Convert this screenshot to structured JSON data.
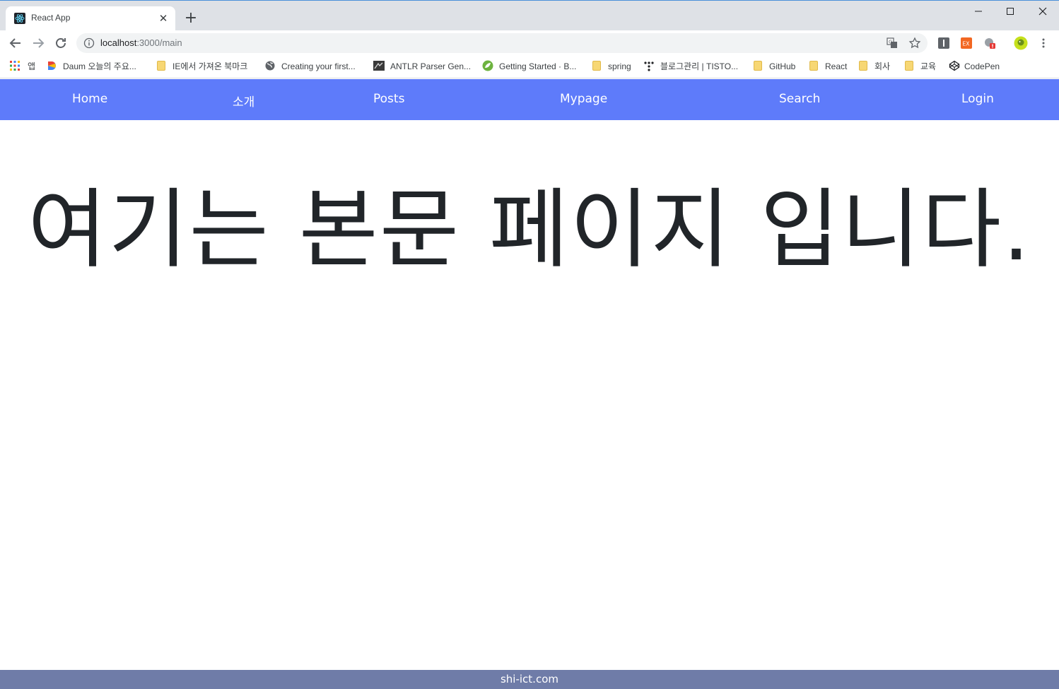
{
  "browser": {
    "tab_title": "React App",
    "url_host": "localhost",
    "url_path": ":3000/main",
    "bookmarks": [
      {
        "label": "앱",
        "icon": "apps-grid-icon"
      },
      {
        "label": "Daum 오늘의 주요...",
        "icon": "daum-icon"
      },
      {
        "label": "IE에서 가져온 북마크",
        "icon": "folder-icon"
      },
      {
        "label": "Creating your first...",
        "icon": "globe-icon"
      },
      {
        "label": "ANTLR Parser Gen...",
        "icon": "antlr-icon"
      },
      {
        "label": "Getting Started · B...",
        "icon": "spring-icon"
      },
      {
        "label": "spring",
        "icon": "folder-icon"
      },
      {
        "label": "블로그관리 | TISTO...",
        "icon": "tistory-icon"
      },
      {
        "label": "GitHub",
        "icon": "folder-icon"
      },
      {
        "label": "React",
        "icon": "folder-icon"
      },
      {
        "label": "회사",
        "icon": "folder-icon"
      },
      {
        "label": "교육",
        "icon": "folder-icon"
      },
      {
        "label": "CodePen",
        "icon": "codepen-icon"
      }
    ]
  },
  "nav": {
    "home": "Home",
    "about": "소개",
    "posts": "Posts",
    "mypage": "Mypage",
    "search": "Search",
    "login": "Login"
  },
  "main": {
    "heading": "여기는 본문 페이지 입니다."
  },
  "footer": {
    "text": "shi-ict.com"
  },
  "colors": {
    "navbar_bg": "#5e7bfa",
    "footer_bg": "#6f7ca8",
    "heading_text": "#212529"
  }
}
